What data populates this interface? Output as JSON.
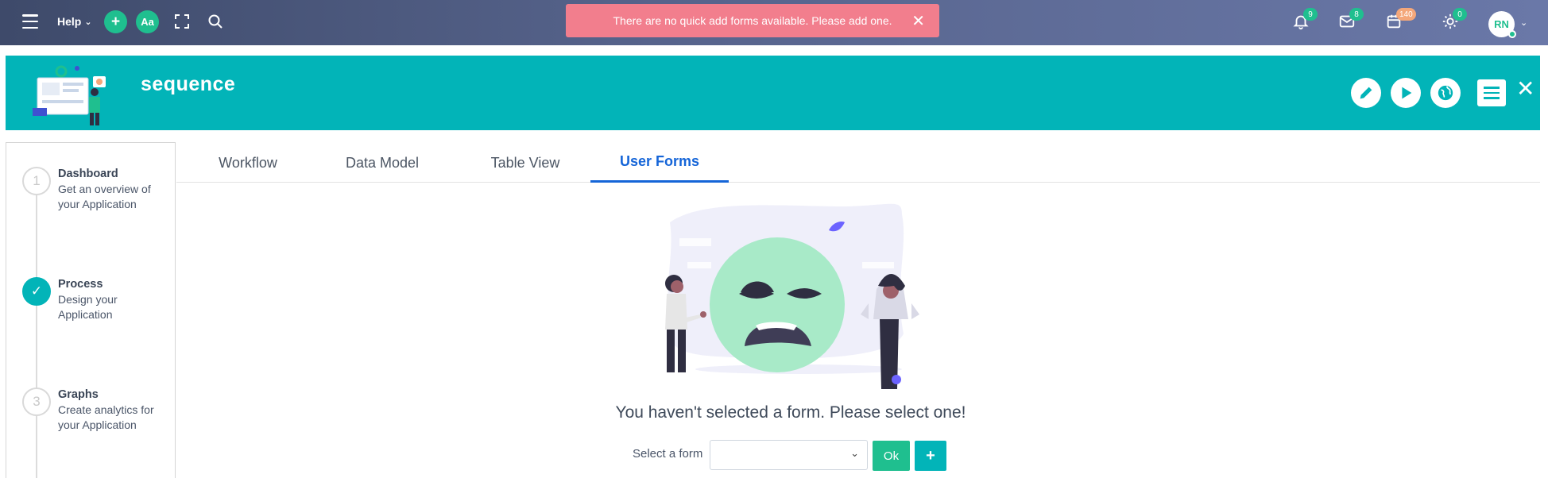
{
  "topbar": {
    "help_label": "Help",
    "add_label": "+",
    "font_label": "Aa",
    "alert_text": "There are no quick add forms available. Please add one.",
    "alert_close": "✕",
    "notifications_count": "9",
    "messages_count": "8",
    "calendar_count": "140",
    "theme_count": "0",
    "avatar_initials": "RN"
  },
  "header": {
    "app_name": "sequence",
    "close_label": "✕"
  },
  "stepper": {
    "steps": [
      {
        "number": "1",
        "title": "Dashboard",
        "description": "Get an overview of your Application"
      },
      {
        "number": "✓",
        "title": "Process",
        "description": "Design your Application"
      },
      {
        "number": "3",
        "title": "Graphs",
        "description": "Create analytics for your Application"
      }
    ]
  },
  "tabs": [
    {
      "label": "Workflow"
    },
    {
      "label": "Data Model"
    },
    {
      "label": "Table View"
    },
    {
      "label": "User Forms"
    }
  ],
  "main": {
    "empty_message": "You haven't selected a form. Please select one!",
    "select_label": "Select a form",
    "select_value": "",
    "ok_label": "Ok",
    "add_label": "+"
  },
  "colors": {
    "teal": "#02b4b8",
    "green": "#1fbf8f",
    "alert_red": "#f27e8d",
    "active_tab": "#1565d8"
  }
}
